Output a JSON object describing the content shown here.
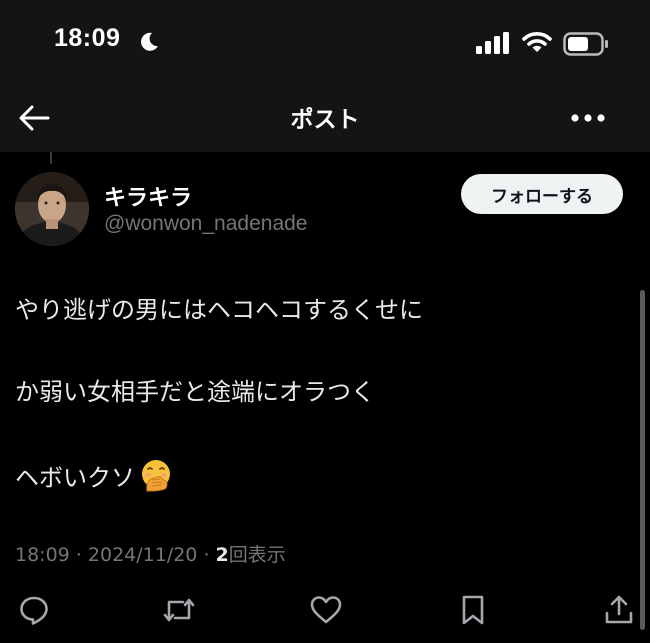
{
  "status_bar": {
    "time": "18:09",
    "icons": [
      "moon-icon",
      "signal-icon",
      "wifi-icon",
      "battery-icon"
    ]
  },
  "header": {
    "title": "ポスト",
    "back_icon": "arrow-left-icon",
    "more_icon": "more-dots-icon"
  },
  "author": {
    "display_name": "キラキラ",
    "handle": "@wonwon_nadenade",
    "follow_label": "フォローする"
  },
  "post": {
    "lines": [
      "やり逃げの男にはヘコヘコするくせに",
      "か弱い女相手だと途端にオラつく",
      "ヘボいクソ"
    ],
    "emoji": "hand-over-mouth-emoji"
  },
  "meta": {
    "time": "18:09",
    "separator": " · ",
    "date": "2024/11/20",
    "views_count": "2",
    "views_label": "回表示"
  },
  "actions": [
    "reply-icon",
    "repost-icon",
    "like-icon",
    "bookmark-icon",
    "share-icon"
  ],
  "colors": {
    "background": "#000000",
    "bar": "#141414",
    "text": "#e7e9ea",
    "secondary_text": "#71767b",
    "follow_button_bg": "#eff3f4"
  }
}
